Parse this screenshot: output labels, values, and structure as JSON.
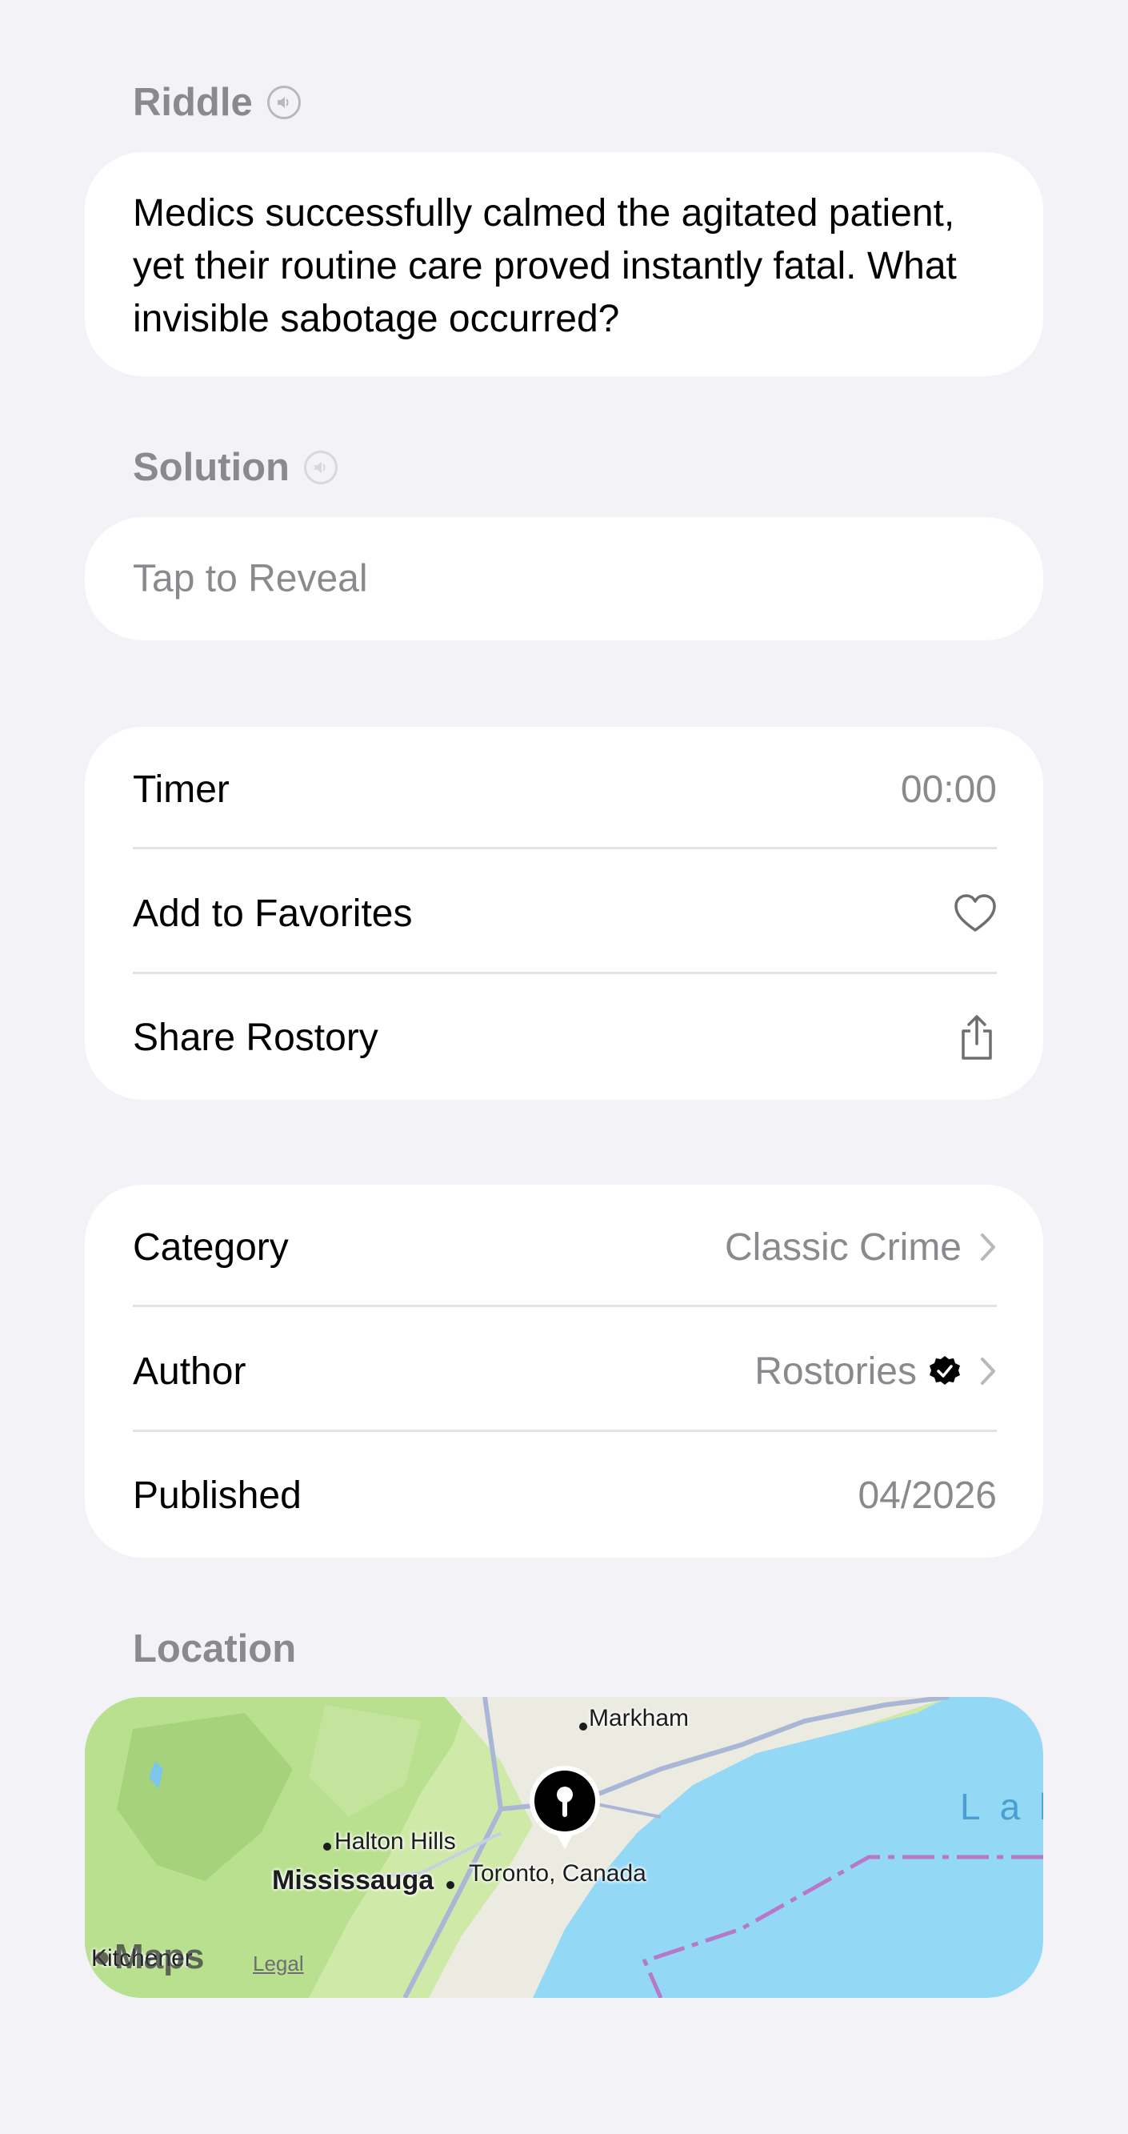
{
  "riddle": {
    "label": "Riddle",
    "text": "Medics successfully calmed the agitated patient, yet their routine care proved instantly fatal. What invisible sabotage occurred?"
  },
  "solution": {
    "label": "Solution",
    "placeholder": "Tap to Reveal"
  },
  "actions": {
    "timer_label": "Timer",
    "timer_value": "00:00",
    "favorites_label": "Add to Favorites",
    "share_label": "Share Rostory"
  },
  "details": {
    "category_label": "Category",
    "category_value": "Classic Crime",
    "author_label": "Author",
    "author_value": "Rostories",
    "published_label": "Published",
    "published_value": "04/2026"
  },
  "location": {
    "label": "Location",
    "map_places": {
      "markham": "Markham",
      "halton_hills": "Halton Hills",
      "mississauga": "Mississauga",
      "toronto": "Toronto, Canada",
      "kitchener": "Kitchener",
      "lake": "Lak"
    },
    "maps_brand": "Maps",
    "legal": "Legal"
  },
  "icons": {
    "speaker": "speaker-icon",
    "heart": "heart-icon",
    "share": "share-icon",
    "chevron": "chevron-right-icon",
    "verified": "verified-badge-icon",
    "pin": "map-pin-icon"
  }
}
